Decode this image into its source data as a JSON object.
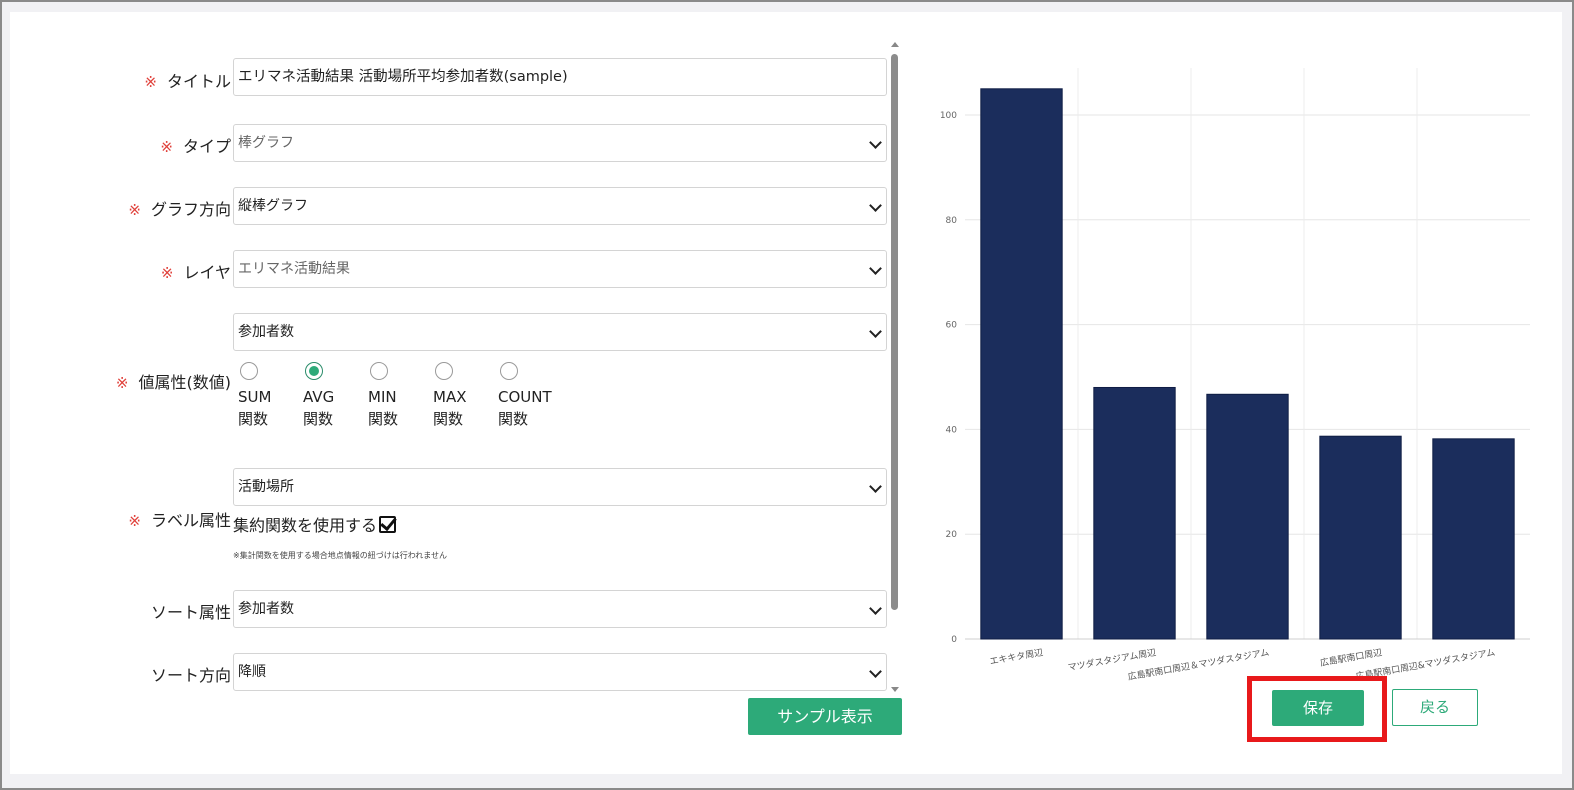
{
  "form": {
    "required_mark": "※",
    "title": {
      "label": "タイトル",
      "value": "エリマネ活動結果 活動場所平均参加者数(sample)"
    },
    "type": {
      "label": "タイプ",
      "value": "棒グラフ"
    },
    "direction": {
      "label": "グラフ方向",
      "value": "縦棒グラフ"
    },
    "layer": {
      "label": "レイヤ",
      "value": "エリマネ活動結果"
    },
    "value_attr": {
      "label": "値属性(数値)",
      "value": "参加者数",
      "functions": [
        {
          "name": "SUM",
          "suffix": "関数",
          "selected": false
        },
        {
          "name": "AVG",
          "suffix": "関数",
          "selected": true
        },
        {
          "name": "MIN",
          "suffix": "関数",
          "selected": false
        },
        {
          "name": "MAX",
          "suffix": "関数",
          "selected": false
        },
        {
          "name": "COUNT",
          "suffix": "関数",
          "selected": false
        }
      ]
    },
    "label_attr": {
      "label": "ラベル属性",
      "value": "活動場所",
      "use_aggregate": "集約関数を使用する",
      "use_aggregate_checked": true,
      "note": "※集計関数を使用する場合地点情報の紐づけは行われません"
    },
    "sort_attr": {
      "label": "ソート属性",
      "value": "参加者数"
    },
    "sort_dir": {
      "label": "ソート方向",
      "value": "降順"
    },
    "sample_button": "サンプル表示"
  },
  "actions": {
    "save": "保存",
    "back": "戻る"
  },
  "colors": {
    "accent": "#2daa79",
    "bar": "#1b2d5c",
    "required": "#e0403a",
    "highlight": "#e8191b"
  },
  "chart_data": {
    "type": "bar",
    "categories": [
      "エキキタ周辺",
      "マツダスタジアム周辺",
      "広島駅南口周辺＆マツダスタジアム",
      "広島駅南口周辺",
      "広島駅南口周辺&マツダスタジアム"
    ],
    "values": [
      105,
      48,
      46.7,
      38.7,
      38.2
    ],
    "yticks": [
      "0",
      "20",
      "40",
      "60",
      "80",
      "100"
    ],
    "ylim": [
      0,
      100
    ],
    "grid": true,
    "title": "",
    "xlabel": "",
    "ylabel": ""
  }
}
